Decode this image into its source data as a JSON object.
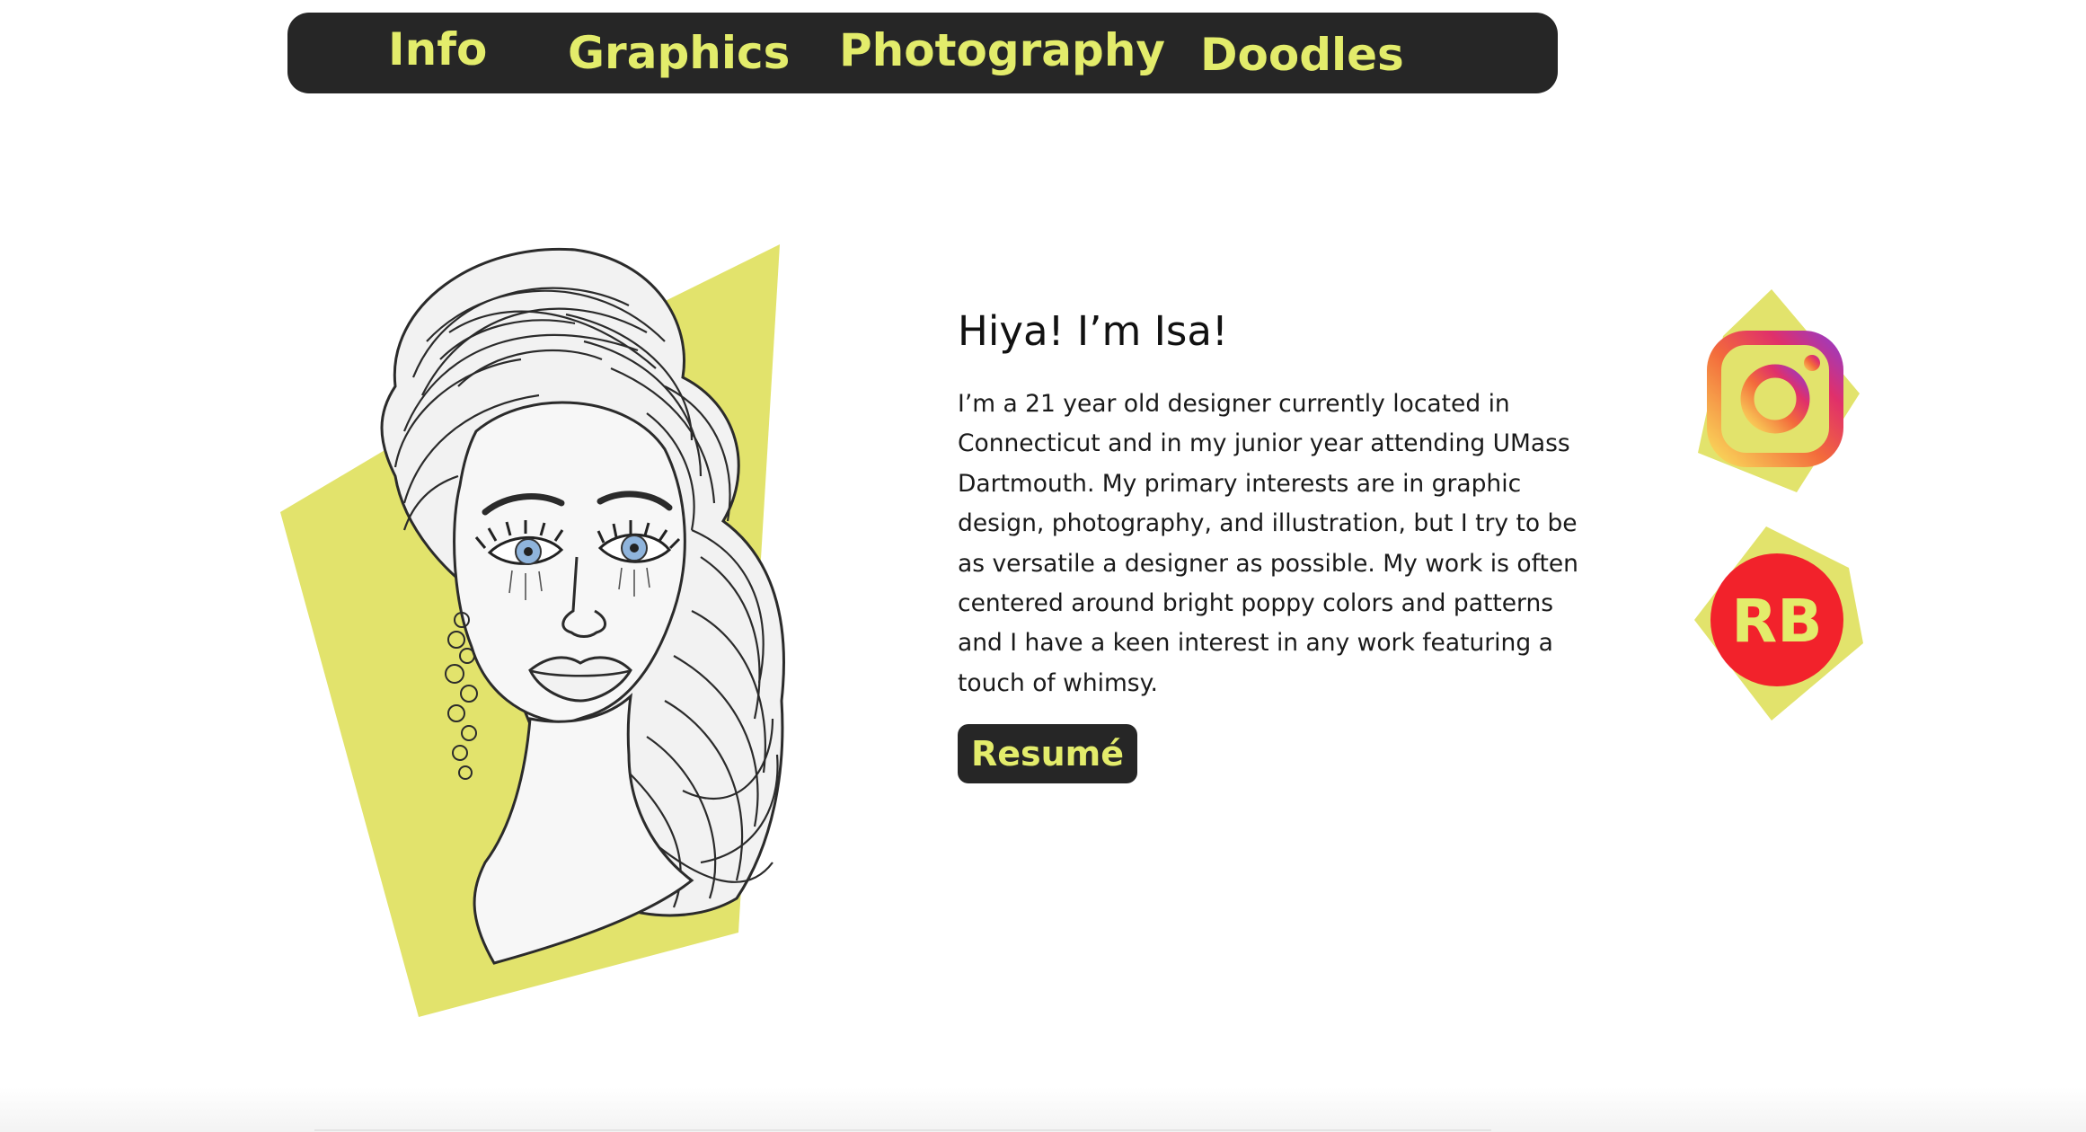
{
  "nav": {
    "items": [
      {
        "label": "Info"
      },
      {
        "label": "Graphics"
      },
      {
        "label": "Photography"
      },
      {
        "label": "Doodles"
      }
    ]
  },
  "about": {
    "heading": "Hiya! I’m Isa!",
    "bio": "I’m a 21 year old designer currently located in Connecticut and in my junior year attending UMass Dartmouth. My primary interests are in graphic design, photography, and illustration, but I try to be as versatile a designer as possible. My work is often centered around bright poppy colors and patterns and I have a keen interest in any work featuring a touch of whimsy.",
    "resume_label": "Resumé"
  },
  "social": {
    "redbubble_logo_text": "RB",
    "icons": [
      "instagram-icon",
      "redbubble-icon"
    ]
  },
  "colors": {
    "accent": "#e3ec6b",
    "shape_yellow": "#e2e36c",
    "dark": "#262626",
    "redbubble_red": "#f2222b"
  }
}
